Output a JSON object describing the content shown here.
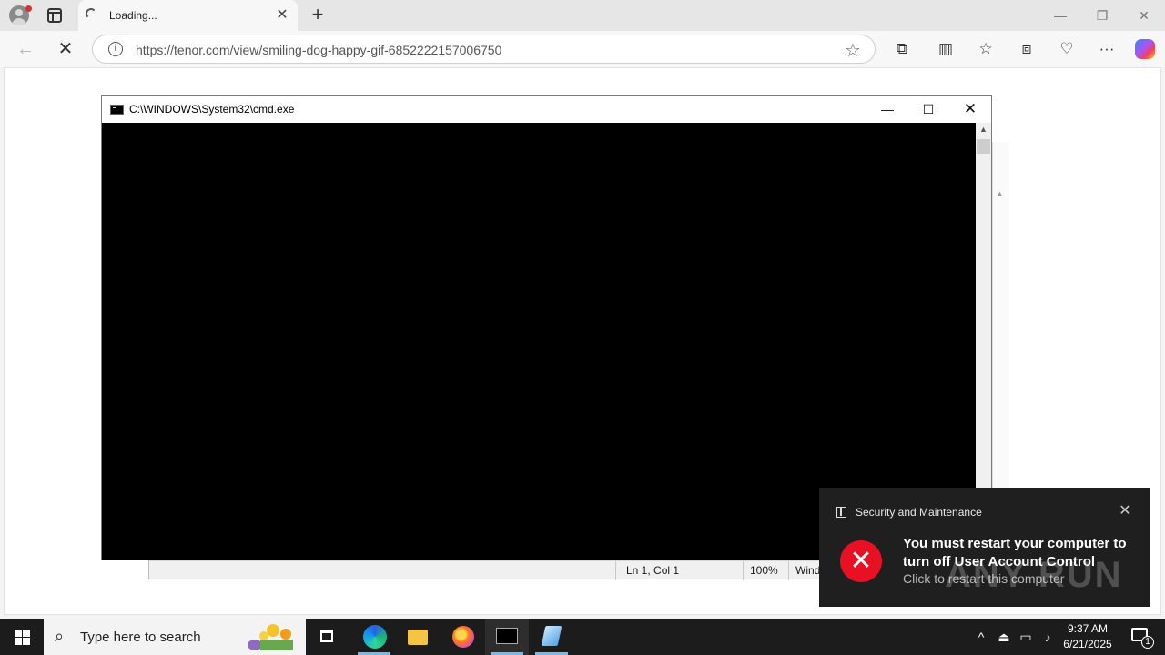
{
  "browser": {
    "tab": {
      "title": "Loading..."
    },
    "address": {
      "url": "https://tenor.com/view/smiling-dog-happy-gif-6852222157006750"
    },
    "icons": {
      "profile": "profile-avatar-icon",
      "tab_actions": "tab-actions-icon",
      "new_tab": "plus-icon",
      "back": "arrow-left-icon",
      "stop": "close-icon",
      "info": "info-icon",
      "favorite": "star-icon",
      "extensions": "puzzle-icon",
      "split": "split-screen-icon",
      "favorites": "favorites-icon",
      "collections": "collections-icon",
      "performance": "heart-pulse-icon",
      "more": "ellipsis-icon",
      "copilot": "copilot-icon"
    }
  },
  "cmd_window": {
    "title": "C:\\WINDOWS\\System32\\cmd.exe"
  },
  "background_window": {
    "status": {
      "position": "Ln 1, Col 1",
      "zoom": "100%",
      "encoding": "Wind"
    }
  },
  "toast": {
    "app": "Security and Maintenance",
    "title": "You must restart your computer to turn off User Account Control",
    "body": "Click to restart this computer",
    "watermark": "ANY RUN",
    "error_color": "#e81123"
  },
  "taskbar": {
    "search_placeholder": "Type here to search",
    "clock": {
      "time": "9:37 AM",
      "date": "6/21/2025"
    },
    "notification_count": "1",
    "accent": "#76b9ed"
  }
}
